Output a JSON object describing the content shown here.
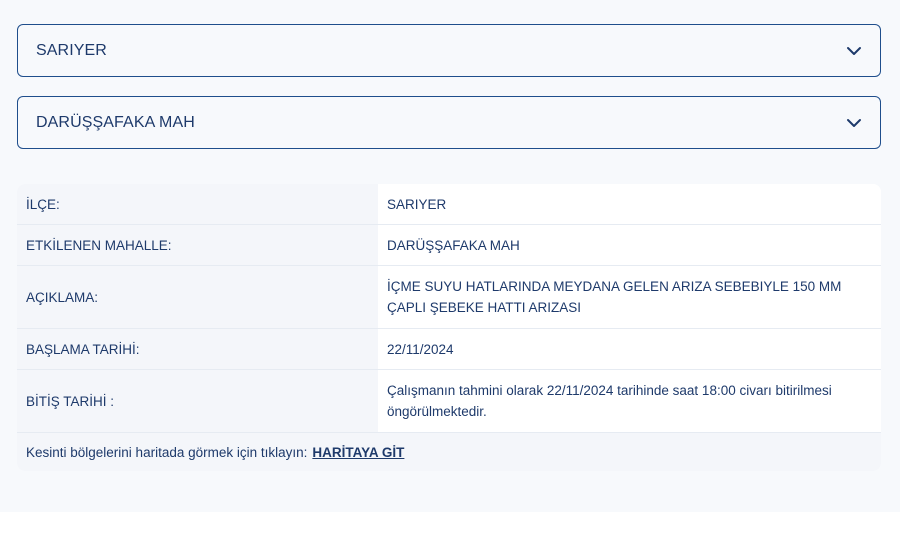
{
  "filters": {
    "district": {
      "selected": "SARIYER",
      "icon": "chevron-down-icon"
    },
    "neighborhood": {
      "selected": "DARÜŞŞAFAKA MAH",
      "icon": "chevron-down-icon"
    }
  },
  "details": {
    "rows": [
      {
        "label": "İLÇE:",
        "value": "SARIYER"
      },
      {
        "label": "ETKİLENEN MAHALLE:",
        "value": "DARÜŞŞAFAKA MAH"
      },
      {
        "label": "AÇIKLAMA:",
        "value": "İÇME SUYU HATLARINDA MEYDANA GELEN ARIZA SEBEBIYLE 150 MM ÇAPLI ŞEBEKE HATTI ARIZASI"
      },
      {
        "label": "BAŞLAMA TARİHİ:",
        "value": "22/11/2024"
      },
      {
        "label": "BİTİŞ TARİHİ :",
        "value": "Çalışmanın tahmini olarak 22/11/2024 tarihinde saat 18:00 civarı bitirilmesi öngörülmektedir."
      }
    ],
    "footer": {
      "text": "Kesinti bölgelerini haritada görmek için tıklayın:",
      "link": "HARİTAYA GİT"
    }
  },
  "colors": {
    "primary": "#1e3a6b",
    "border": "#1f4e8c",
    "background": "#f7f9fc"
  }
}
